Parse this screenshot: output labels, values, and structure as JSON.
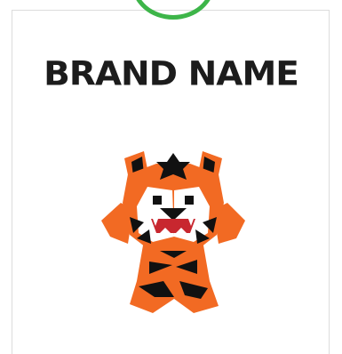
{
  "brand": {
    "name": "BRAND NAME"
  },
  "icons": {
    "badge": "green-ring-badge-icon",
    "mascot": "tiger-mascot-logo"
  },
  "colors": {
    "badge_ring": "#3db549",
    "tiger_orange": "#f26a23",
    "tiger_black": "#111111",
    "tiger_red": "#c8272f",
    "text": "#1c1c1c"
  }
}
